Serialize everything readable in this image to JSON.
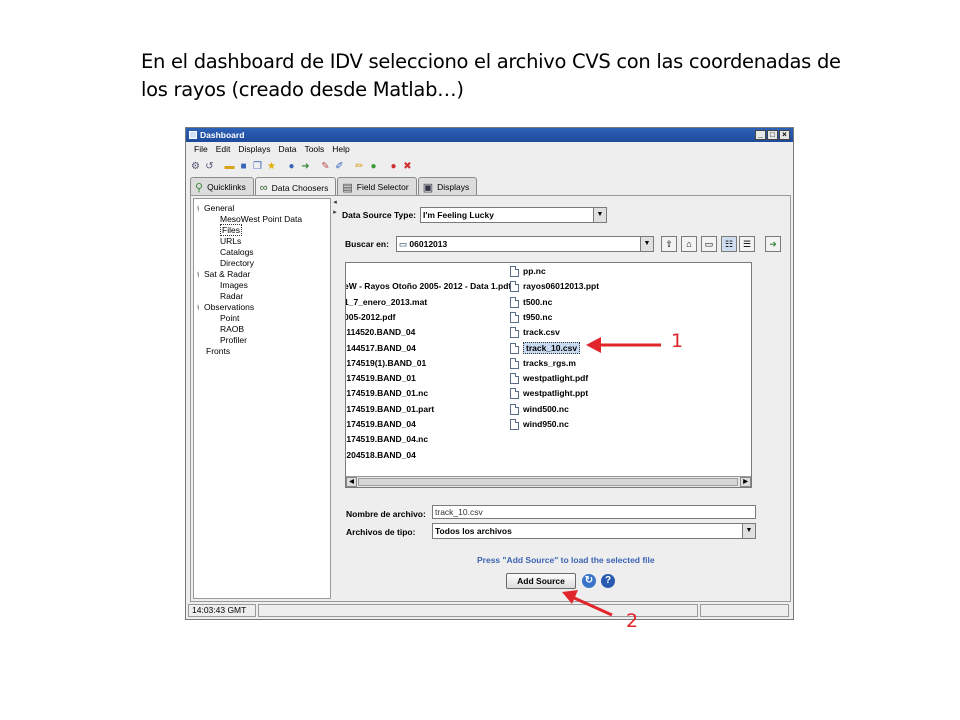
{
  "caption": "En el dashboard de IDV selecciono el archivo CVS con las coordenadas de los rayos (creado desde Matlab…)",
  "window": {
    "title": "Dashboard",
    "buttons": [
      "_",
      "□",
      "×"
    ]
  },
  "menubar": [
    "File",
    "Edit",
    "Displays",
    "Data",
    "Tools",
    "Help"
  ],
  "tabs": [
    {
      "label": "Quicklinks",
      "icon": "quicklinks-icon"
    },
    {
      "label": "Data Choosers",
      "icon": "binoculars-icon"
    },
    {
      "label": "Field Selector",
      "icon": "field-icon"
    },
    {
      "label": "Displays",
      "icon": "monitor-icon"
    }
  ],
  "tree": [
    {
      "label": "General",
      "expand": true
    },
    {
      "label": "MesoWest Point Data"
    },
    {
      "label": "Files",
      "selected": true
    },
    {
      "label": "URLs"
    },
    {
      "label": "Catalogs"
    },
    {
      "label": "Directory"
    },
    {
      "label": "Sat & Radar",
      "expand": true
    },
    {
      "label": "Images"
    },
    {
      "label": "Radar"
    },
    {
      "label": "Observations",
      "expand": true
    },
    {
      "label": "Point"
    },
    {
      "label": "RAOB"
    },
    {
      "label": "Profiler"
    },
    {
      "label": "Fronts"
    }
  ],
  "data_source": {
    "label": "Data Source Type:",
    "value": "I'm Feeling Lucky"
  },
  "buscar": {
    "label": "Buscar en:",
    "value": "06012013"
  },
  "files_left": [
    "eW - Rayos Otoño 2005- 2012 - Data 1.pdf",
    "1_7_enero_2013.mat",
    "005-2012.pdf",
    ".114520.BAND_04",
    ".144517.BAND_04",
    ".174519(1).BAND_01",
    ".174519.BAND_01",
    ".174519.BAND_01.nc",
    ".174519.BAND_01.part",
    ".174519.BAND_04",
    ".174519.BAND_04.nc",
    ".204518.BAND_04"
  ],
  "files_right": [
    "pp.nc",
    "rayos06012013.ppt",
    "t500.nc",
    "t950.nc",
    "track.csv",
    "track_10.csv",
    "tracks_rgs.m",
    "westpatlight.pdf",
    "westpatlight.ppt",
    "wind500.nc",
    "wind950.nc"
  ],
  "selected_file_index": 5,
  "filename": {
    "label": "Nombre de archivo:",
    "value": "track_10.csv"
  },
  "filetype": {
    "label": "Archivos de tipo:",
    "value": "Todos los archivos"
  },
  "hint": "Press \"Add Source\" to load the selected file",
  "add_source": "Add Source",
  "status": {
    "time": "14:03:43 GMT"
  },
  "annotations": {
    "one": "1",
    "two": "2",
    "color": "#e0252b"
  }
}
